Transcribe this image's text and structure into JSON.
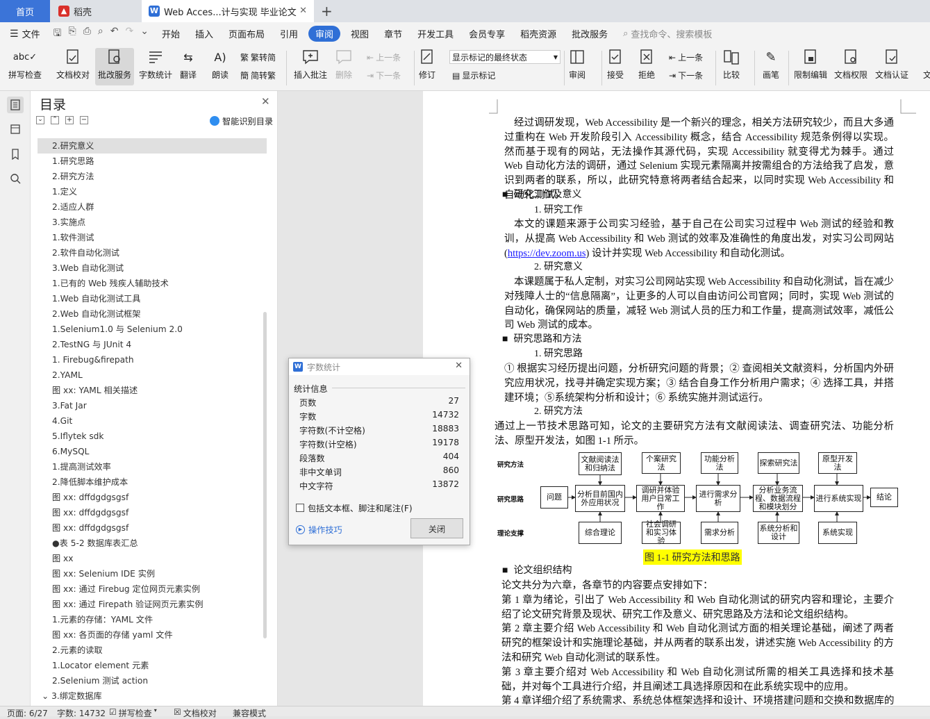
{
  "tabs": {
    "home": "首页",
    "dao": "稻壳",
    "doc": "Web Acces...计与实现 毕业论文",
    "add": "+"
  },
  "menu": {
    "file": "文件",
    "items": [
      "开始",
      "插入",
      "页面布局",
      "引用",
      "审阅",
      "视图",
      "章节",
      "开发工具",
      "会员专享",
      "稻壳资源",
      "批改服务"
    ],
    "search": "查找命令、搜索模板"
  },
  "ribbon": {
    "spell": "拼写检查",
    "doc_check": "文档校对",
    "review_service": "批改服务",
    "word_count": "字数统计",
    "translate": "翻译",
    "read_aloud": "朗读",
    "to_trad": "繁转简",
    "to_simp": "简转繁",
    "insert_comment": "插入批注",
    "delete": "删除",
    "prev": "上一条",
    "next": "下一条",
    "markup_dropdown": "显示标记的最终状态",
    "revise": "修订",
    "show_markup": "显示标记",
    "review": "审阅",
    "accept": "接受",
    "reject": "拒绝",
    "prev2": "上一条",
    "next2": "下一条",
    "compare": "比较",
    "pen": "画笔",
    "restrict_edit": "限制编辑",
    "doc_rights": "文档权限",
    "doc_cert": "文档认证",
    "doc_more": "文"
  },
  "toc": {
    "title": "目录",
    "smart": "智能识别目录",
    "items": [
      "2.研究意义",
      "1.研究思路",
      "2.研究方法",
      "1.定义",
      "2.适应人群",
      "3.实施点",
      "1.软件测试",
      "2.软件自动化测试",
      "3.Web 自动化测试",
      "1.已有的 Web 残疾人辅助技术",
      "1.Web 自动化测试工具",
      "2.Web 自动化测试框架",
      "1.Selenium1.0 与 Selenium 2.0",
      "2.TestNG 与 JUnit 4",
      "1.  Firebug&firepath",
      "2.YAML",
      "图 xx: YAML 相关描述",
      "3.Fat Jar",
      "4.Git",
      "5.Iflytek sdk",
      "6.MySQL",
      "1.提高测试效率",
      "2.降低脚本维护成本",
      "图 xx: dffdgdgsgsf",
      "图 xx: dffdgdgsgsf",
      "图 xx: dffdgdgsgsf",
      "●表 5-2    数据库表汇总",
      "图 xx",
      "图 xx: Selenium IDE 实例",
      "图 xx: 通过 Firebug 定位网页元素实例",
      "图 xx: 通过 Firepath 验证网页元素实例",
      "1.元素的存储：YAML 文件",
      "图 xx: 各页面的存储 yaml 文件",
      "2.元素的读取",
      "1.Locator element 元素",
      "2.Selenium 测试 action",
      "3.绑定数据库"
    ]
  },
  "dialog": {
    "title": "字数统计",
    "section": "统计信息",
    "rows": [
      {
        "k": "页数",
        "v": "27"
      },
      {
        "k": "字数",
        "v": "14732"
      },
      {
        "k": "字符数(不计空格)",
        "v": "18883"
      },
      {
        "k": "字符数(计空格)",
        "v": "19178"
      },
      {
        "k": "段落数",
        "v": "404"
      },
      {
        "k": "非中文单词",
        "v": "860"
      },
      {
        "k": "中文字符",
        "v": "13872"
      }
    ],
    "include": "包括文本框、脚注和尾注(F)",
    "tips": "操作技巧",
    "close": "关闭"
  },
  "doc": {
    "p1": "经过调研发现，Web Accessibility 是一个新兴的理念，相关方法研究较少，而且大多通过重构在 Web 开发阶段引入 Accessibility 概念，结合 Accessibility 规范条例得以实现。然而基于现有的网站，无法操作其源代码，实现 Accessibility 就变得尤为棘手。通过 Web 自动化方法的调研，通过 Selenium 实现元素隔离并按需组合的方法给我了启发，意识到两者的联系，所以，此研究特意将两者结合起来，以同时实现 Web Accessibility 和自动化测试。",
    "h1": "研究工作及意义",
    "h1a": "1.    研究工作",
    "p2a": "本文的课题来源于公司实习经验，基于自己在公司实习过程中 Web 测试的经验和教训，从提高 Web Accessibility 和 Web 测试的效率及准确性的角度出发，对实习公司网站",
    "link": "https://dev.zoom.us",
    "p2b": "设计并实现 Web Accessibility 和自动化测试。",
    "h1b": "2.    研究意义",
    "p3": "本课题属于私人定制，对实习公司网站实现 Web Accessibility 和自动化测试，旨在减少对残障人士的“信息隔离”，让更多的人可以自由访问公司官网；同时，实现 Web 测试的自动化，确保网站的质量，减轻 Web 测试人员的压力和工作量，提高测试效率，减低公司 Web 测试的成本。",
    "h2": "研究思路和方法",
    "h2a": "1.    研究思路",
    "p4": "① 根据实习经历提出问题，分析研究问题的背景；② 查阅相关文献资料，分析国内外研究应用状况，找寻并确定实现方案；③ 结合自身工作分析用户需求；④ 选择工具，并搭建环境；⑤系统架构分析和设计；⑥ 系统实施并测试运行。",
    "h2b": "2.    研究方法",
    "p5": "通过上一节技术思路可知，论文的主要研究方法有文献阅读法、调查研究法、功能分析法、原型开发法，如图 1-1 所示。",
    "fig_caption": "图 1-1   研究方法和思路",
    "h3": "论文组织结构",
    "p6": "论文共分为六章，各章节的内容要点安排如下：",
    "p7": "第 1 章为绪论，引出了 Web Accessibility 和 Web 自动化测试的研究内容和理论，主要介绍了论文研究背景及现状、研究工作及意义、研究思路及方法和论文组织结构。",
    "p8": "第 2 章主要介绍 Web Accessibility 和 Web 自动化测试方面的相关理论基础，阐述了两者研究的框架设计和实施理论基础，并从两者的联系出发，讲述实施 Web Accessibility 的方法和研究 Web 自动化测试的联系性。",
    "p9": "第 3 章主要介绍对 Web Accessibility 和 Web 自动化测试所需的相关工具选择和技术基础，并对每个工具进行介绍，并且阐述工具选择原因和在此系统实现中的应用。",
    "p10": "第 4 章详细介绍了系统需求、系统总体框架选择和设计、环境搭建问题和交换和数据库的设"
  },
  "figure": {
    "row_labels": [
      "研究方法",
      "研究思路",
      "理论支撑"
    ],
    "top": [
      "文献阅读法和归纳法",
      "个案研究法",
      "功能分析法",
      "探索研究法",
      "原型开发法"
    ],
    "mid": [
      "问题",
      "分析目前国内外应用状况",
      "调研并体验用户日常工作",
      "进行需求分析",
      "分析业务流程、数据流程和模块划分",
      "进行系统实现",
      "结论"
    ],
    "bot": [
      "综合理论",
      "社会调研和实习体验",
      "需求分析",
      "系统分析和设计",
      "系统实现"
    ]
  },
  "status": {
    "page": "页面: 6/27",
    "words": "字数: 14732",
    "spell": "拼写检查",
    "doc_check": "文档校对",
    "compat": "兼容模式"
  },
  "colors": {
    "accent": "#2f6fd6",
    "home_tab": "#3b74d8",
    "wps_red": "#d9302a",
    "highlight": "#ffff00"
  }
}
